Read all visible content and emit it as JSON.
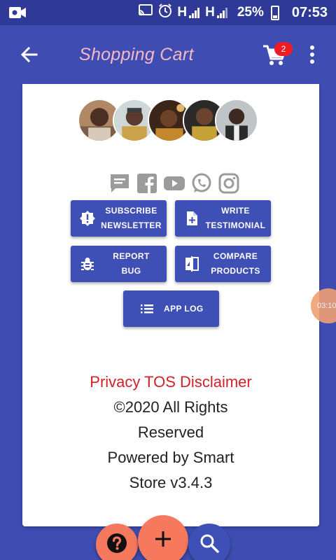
{
  "status_bar": {
    "battery": "25%",
    "time": "07:53",
    "network_1": "H",
    "network_2": "H"
  },
  "app_bar": {
    "title": "Shopping Cart",
    "cart_count": "2"
  },
  "avatars": [
    "member-1",
    "member-2",
    "member-3",
    "member-4",
    "member-5"
  ],
  "social_icons": [
    "message-icon",
    "facebook-icon",
    "youtube-icon",
    "whatsapp-icon",
    "instagram-icon"
  ],
  "buttons": {
    "subscribe": {
      "line1": "SUBSCRIBE",
      "line2": "NEWSLETTER"
    },
    "testimonial": {
      "line1": "WRITE",
      "line2": "TESTIMONIAL"
    },
    "report": {
      "line1": "REPORT",
      "line2": "BUG"
    },
    "compare": {
      "line1": "COMPARE",
      "line2": "PRODUCTS"
    },
    "applog": {
      "label": "APP LOG"
    }
  },
  "footer": {
    "links": "Privacy TOS Disclaimer",
    "copyright_line1": "©2020 All Rights",
    "copyright_line2": "Reserved",
    "powered_line1": "Powered by Smart",
    "powered_line2": "Store v3.4.3"
  },
  "bubble": {
    "text": "03:10"
  },
  "colors": {
    "primary": "#3f4db3",
    "status_bar": "#2f3a98",
    "accent": "#f6795e",
    "title": "#f5b9c2",
    "link": "#d32029",
    "badge": "#ee1c24"
  }
}
